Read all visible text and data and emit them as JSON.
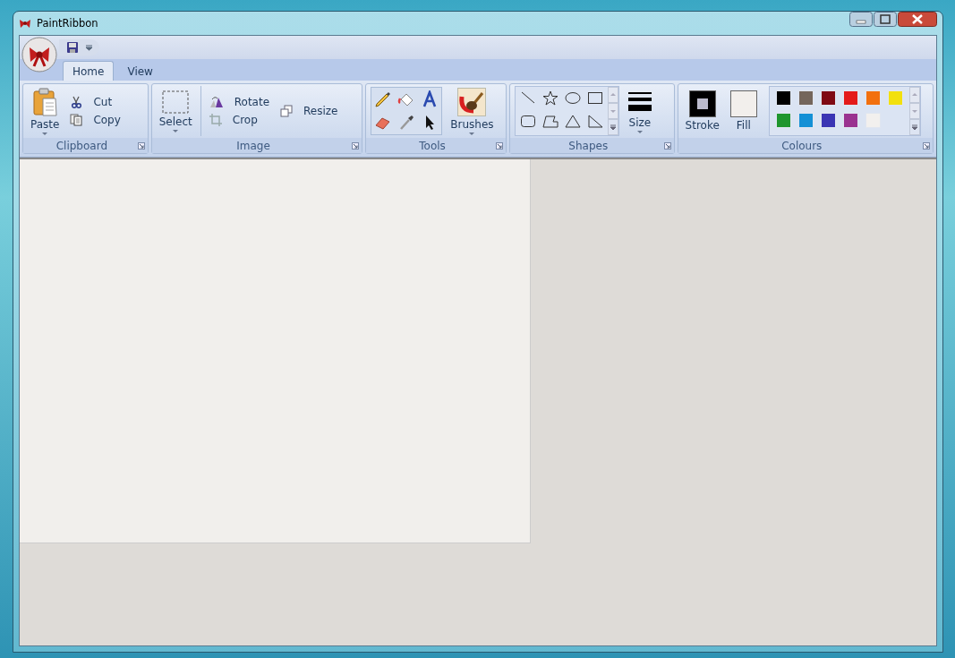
{
  "window": {
    "title": "PaintRibbon"
  },
  "tabs": [
    {
      "label": "Home",
      "selected": true
    },
    {
      "label": "View",
      "selected": false
    }
  ],
  "ribbon": {
    "clipboard": {
      "label": "Clipboard",
      "paste": "Paste",
      "cut": "Cut",
      "copy": "Copy"
    },
    "image": {
      "label": "Image",
      "select": "Select",
      "rotate": "Rotate",
      "crop": "Crop",
      "resize": "Resize"
    },
    "tools": {
      "label": "Tools",
      "brushes": "Brushes"
    },
    "shapes": {
      "label": "Shapes",
      "size": "Size"
    },
    "colours": {
      "label": "Colours",
      "stroke": {
        "label": "Stroke",
        "color": "#000000"
      },
      "fill": {
        "label": "Fill",
        "color": "#f2efec"
      },
      "palette": [
        {
          "color": "#000000"
        },
        {
          "color": "#74665c"
        },
        {
          "color": "#7f0a14"
        },
        {
          "color": "#e41a1a"
        },
        {
          "color": "#f2700e"
        },
        {
          "color": "#f2e00e"
        },
        {
          "color": "#1f962e"
        },
        {
          "color": "#1490d6"
        },
        {
          "color": "#3b35b4"
        },
        {
          "color": "#9a3290"
        },
        {
          "color": "#f2f0ee"
        }
      ]
    }
  }
}
